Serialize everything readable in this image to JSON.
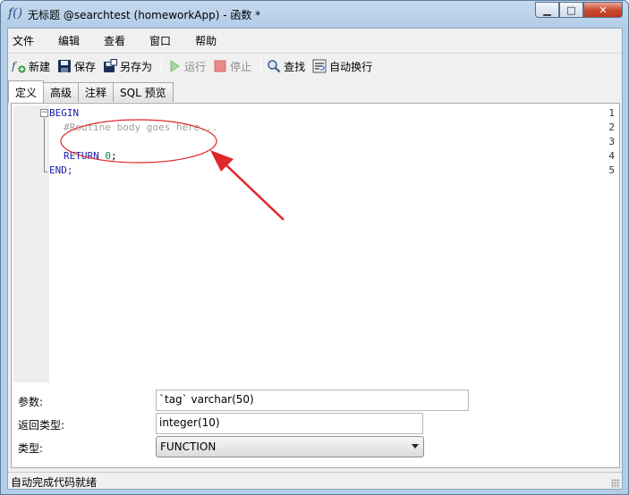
{
  "window": {
    "title": "无标题 @searchtest (homeworkApp) - 函数 *",
    "icon_glyph": "f()",
    "controls": {
      "minimize": "▁",
      "maximize": "□",
      "close": "✕"
    }
  },
  "menu": {
    "items": [
      {
        "label": "文件"
      },
      {
        "label": "编辑"
      },
      {
        "label": "查看"
      },
      {
        "label": "窗口"
      },
      {
        "label": "帮助"
      }
    ]
  },
  "toolbar": {
    "new_label": "新建",
    "save_label": "保存",
    "save_as_label": "另存为",
    "run_label": "运行",
    "stop_label": "停止",
    "find_label": "查找",
    "wrap_label": "自动换行"
  },
  "tabs": [
    {
      "label": "定义",
      "active": true
    },
    {
      "label": "高级",
      "active": false
    },
    {
      "label": "注释",
      "active": false
    },
    {
      "label": "SQL 预览",
      "active": false
    }
  ],
  "editor": {
    "line_numbers": [
      "1",
      "2",
      "3",
      "4",
      "5"
    ],
    "fold_open": "−",
    "lines": {
      "l1": "BEGIN",
      "l2": "#Routine body goes here...",
      "l4_kw": "RETURN",
      "l4_num": "0",
      "l4_end": ";",
      "l5": "END;"
    }
  },
  "form": {
    "params_label": "参数:",
    "params_value": "`tag` varchar(50)",
    "return_label": "返回类型:",
    "return_value": "integer(10)",
    "type_label": "类型:",
    "type_value": "FUNCTION"
  },
  "status": {
    "text": "自动完成代码就绪"
  },
  "colors": {
    "annotation_red": "#e0262a",
    "keyword": "#1a1aa6",
    "comment": "#a0a0a0",
    "number": "#0a8a3a"
  }
}
